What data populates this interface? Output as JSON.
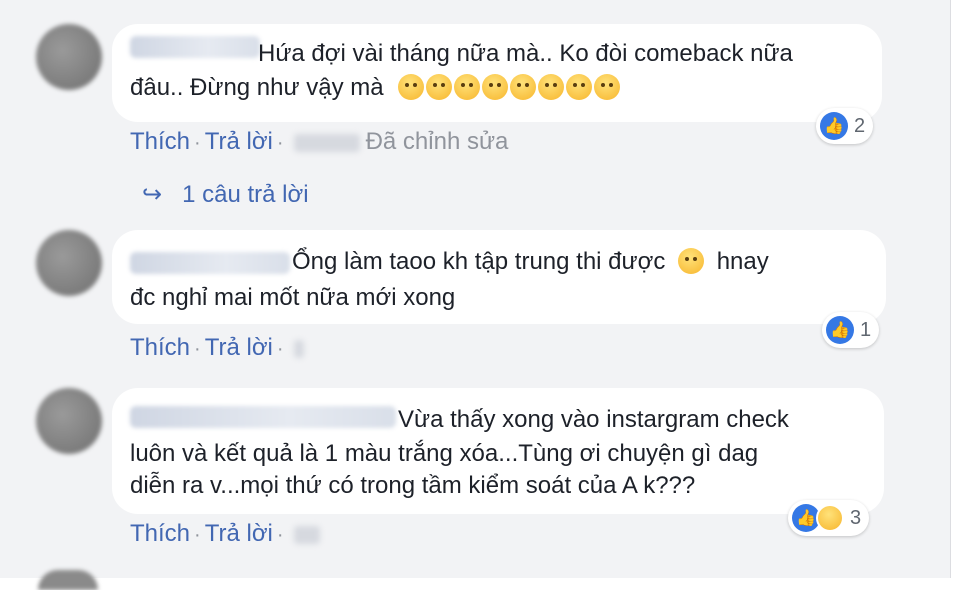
{
  "comments": [
    {
      "text_line1": "Hứa đợi vài tháng nữa mà.. Ko đòi comeback nữa",
      "text_line2": "đâu.. Đừng như vậy mà",
      "like": "Thích",
      "reply": "Trả lời",
      "edited": "Đã chỉnh sửa",
      "reaction_count": "2",
      "emoji_count": 8
    },
    {
      "text_line1": "Ổng làm taoo kh tập trung thi được",
      "text_line1_after": "hnay",
      "text_line2": "đc nghỉ mai mốt nữa mới xong",
      "like": "Thích",
      "reply": "Trả lời",
      "reaction_count": "1"
    },
    {
      "text_line1": "Vừa thấy xong vào instargram check",
      "text_line2": "luôn và kết quả là 1 màu trắng xóa...Tùng ơi chuyện gì dag",
      "text_line3": "diễn ra v...mọi thứ có trong tầm kiểm soát của A k???",
      "like": "Thích",
      "reply": "Trả lời",
      "reaction_count": "3"
    }
  ],
  "replies_link": "1 câu trả lời",
  "icons": {
    "like": "like-icon",
    "sad": "sad-icon",
    "reply_arrow": "reply-arrow-icon"
  },
  "colors": {
    "link": "#4267b2",
    "text": "#1d2129",
    "meta": "#90949c",
    "like_blue": "#3578e5"
  }
}
